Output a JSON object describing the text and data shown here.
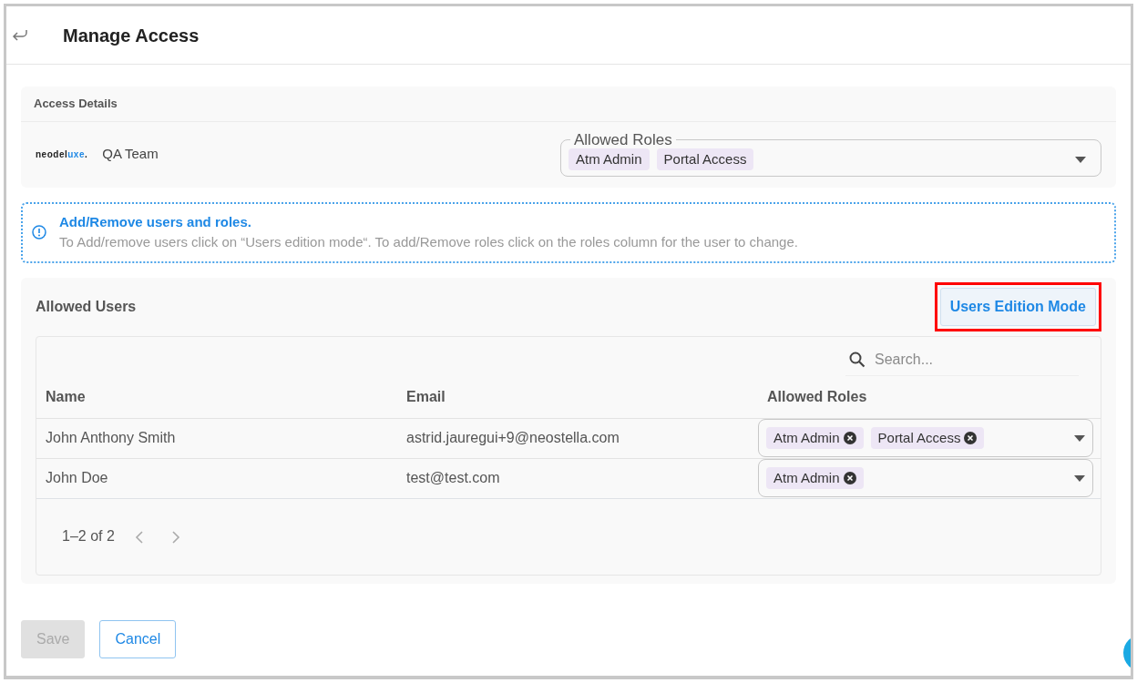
{
  "header": {
    "title": "Manage Access"
  },
  "access_details": {
    "title": "Access Details",
    "logo": {
      "text": "neodel",
      "accent": "uxe",
      "suffix": "."
    },
    "team": "QA Team",
    "roles_field": {
      "label": "Allowed Roles",
      "chips": [
        "Atm Admin",
        "Portal Access"
      ]
    }
  },
  "info": {
    "title": "Add/Remove users and roles.",
    "text": "To Add/remove users click on “Users edition mode“. To add/Remove roles click on the roles column for the user to change."
  },
  "allowed_users": {
    "title": "Allowed Users",
    "mode_button": {
      "label": "Users Edition Mode",
      "highlighted": true
    },
    "search": {
      "placeholder": "Search..."
    },
    "table": {
      "columns": [
        "Name",
        "Email",
        "Allowed Roles"
      ],
      "rows": [
        {
          "name": "John Anthony Smith",
          "email": "astrid.jauregui+9@neostella.com",
          "roles": [
            "Atm Admin",
            "Portal Access"
          ]
        },
        {
          "name": "John Doe",
          "email": "test@test.com",
          "roles": [
            "Atm Admin"
          ]
        }
      ]
    },
    "pagination": {
      "range": "1–2 of 2",
      "prev_disabled": true,
      "next_disabled": true
    }
  },
  "footer": {
    "buttons": [
      {
        "label": "Save",
        "disabled": true
      },
      {
        "label": "Cancel",
        "disabled": false
      }
    ]
  }
}
